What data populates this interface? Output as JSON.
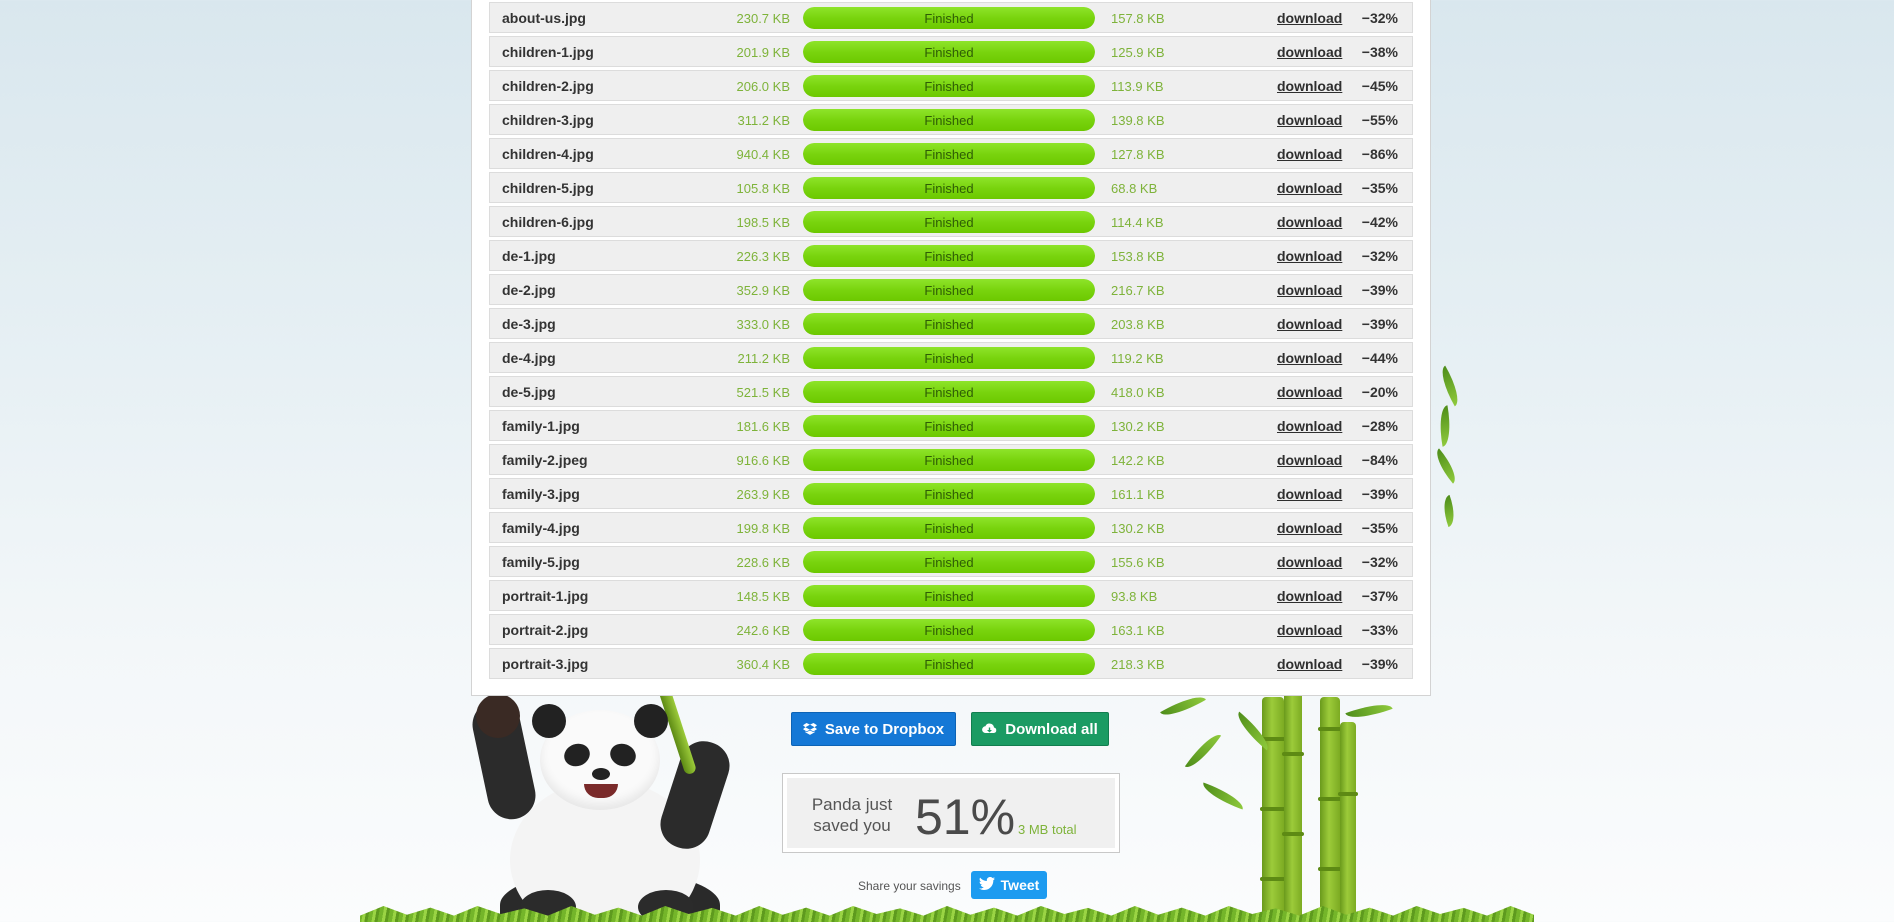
{
  "files": [
    {
      "name": "about-us.jpg",
      "original": "230.7 KB",
      "status": "Finished",
      "progress": 1.0,
      "compressed": "157.8 KB",
      "action": "download",
      "savings": "−32%"
    },
    {
      "name": "children-1.jpg",
      "original": "201.9 KB",
      "status": "Finished",
      "progress": 1.0,
      "compressed": "125.9 KB",
      "action": "download",
      "savings": "−38%"
    },
    {
      "name": "children-2.jpg",
      "original": "206.0 KB",
      "status": "Finished",
      "progress": 1.0,
      "compressed": "113.9 KB",
      "action": "download",
      "savings": "−45%"
    },
    {
      "name": "children-3.jpg",
      "original": "311.2 KB",
      "status": "Finished",
      "progress": 1.0,
      "compressed": "139.8 KB",
      "action": "download",
      "savings": "−55%"
    },
    {
      "name": "children-4.jpg",
      "original": "940.4 KB",
      "status": "Finished",
      "progress": 1.0,
      "compressed": "127.8 KB",
      "action": "download",
      "savings": "−86%"
    },
    {
      "name": "children-5.jpg",
      "original": "105.8 KB",
      "status": "Finished",
      "progress": 1.0,
      "compressed": "68.8 KB",
      "action": "download",
      "savings": "−35%"
    },
    {
      "name": "children-6.jpg",
      "original": "198.5 KB",
      "status": "Finished",
      "progress": 1.0,
      "compressed": "114.4 KB",
      "action": "download",
      "savings": "−42%"
    },
    {
      "name": "de-1.jpg",
      "original": "226.3 KB",
      "status": "Finished",
      "progress": 1.0,
      "compressed": "153.8 KB",
      "action": "download",
      "savings": "−32%"
    },
    {
      "name": "de-2.jpg",
      "original": "352.9 KB",
      "status": "Finished",
      "progress": 1.0,
      "compressed": "216.7 KB",
      "action": "download",
      "savings": "−39%"
    },
    {
      "name": "de-3.jpg",
      "original": "333.0 KB",
      "status": "Finished",
      "progress": 1.0,
      "compressed": "203.8 KB",
      "action": "download",
      "savings": "−39%"
    },
    {
      "name": "de-4.jpg",
      "original": "211.2 KB",
      "status": "Finished",
      "progress": 1.0,
      "compressed": "119.2 KB",
      "action": "download",
      "savings": "−44%"
    },
    {
      "name": "de-5.jpg",
      "original": "521.5 KB",
      "status": "Finished",
      "progress": 1.0,
      "compressed": "418.0 KB",
      "action": "download",
      "savings": "−20%"
    },
    {
      "name": "family-1.jpg",
      "original": "181.6 KB",
      "status": "Finished",
      "progress": 1.0,
      "compressed": "130.2 KB",
      "action": "download",
      "savings": "−28%"
    },
    {
      "name": "family-2.jpeg",
      "original": "916.6 KB",
      "status": "Finished",
      "progress": 1.0,
      "compressed": "142.2 KB",
      "action": "download",
      "savings": "−84%"
    },
    {
      "name": "family-3.jpg",
      "original": "263.9 KB",
      "status": "Finished",
      "progress": 1.0,
      "compressed": "161.1 KB",
      "action": "download",
      "savings": "−39%"
    },
    {
      "name": "family-4.jpg",
      "original": "199.8 KB",
      "status": "Finished",
      "progress": 1.0,
      "compressed": "130.2 KB",
      "action": "download",
      "savings": "−35%"
    },
    {
      "name": "family-5.jpg",
      "original": "228.6 KB",
      "status": "Finished",
      "progress": 1.0,
      "compressed": "155.6 KB",
      "action": "download",
      "savings": "−32%"
    },
    {
      "name": "portrait-1.jpg",
      "original": "148.5 KB",
      "status": "Finished",
      "progress": 1.0,
      "compressed": "93.8 KB",
      "action": "download",
      "savings": "−37%"
    },
    {
      "name": "portrait-2.jpg",
      "original": "242.6 KB",
      "status": "Finished",
      "progress": 1.0,
      "compressed": "163.1 KB",
      "action": "download",
      "savings": "−33%"
    },
    {
      "name": "portrait-3.jpg",
      "original": "360.4 KB",
      "status": "Finished",
      "progress": 1.0,
      "compressed": "218.3 KB",
      "action": "download",
      "savings": "−39%"
    }
  ],
  "actions": {
    "dropbox_label": "Save to Dropbox",
    "dropbox_icon": "dropbox-icon",
    "download_all_label": "Download all",
    "download_all_icon": "cloud-download-icon"
  },
  "savings": {
    "label_line1": "Panda just",
    "label_line2": "saved you",
    "percent": "51%",
    "total": "3 MB total"
  },
  "share": {
    "label": "Share your savings",
    "tweet_label": "Tweet",
    "tweet_icon": "twitter-bird-icon"
  },
  "colors": {
    "progress_green": "#79d40e",
    "size_green": "#7eb33a",
    "dropbox_blue": "#1578d6",
    "download_all_green": "#1b9b63",
    "tweet_blue": "#1d9bf0"
  }
}
